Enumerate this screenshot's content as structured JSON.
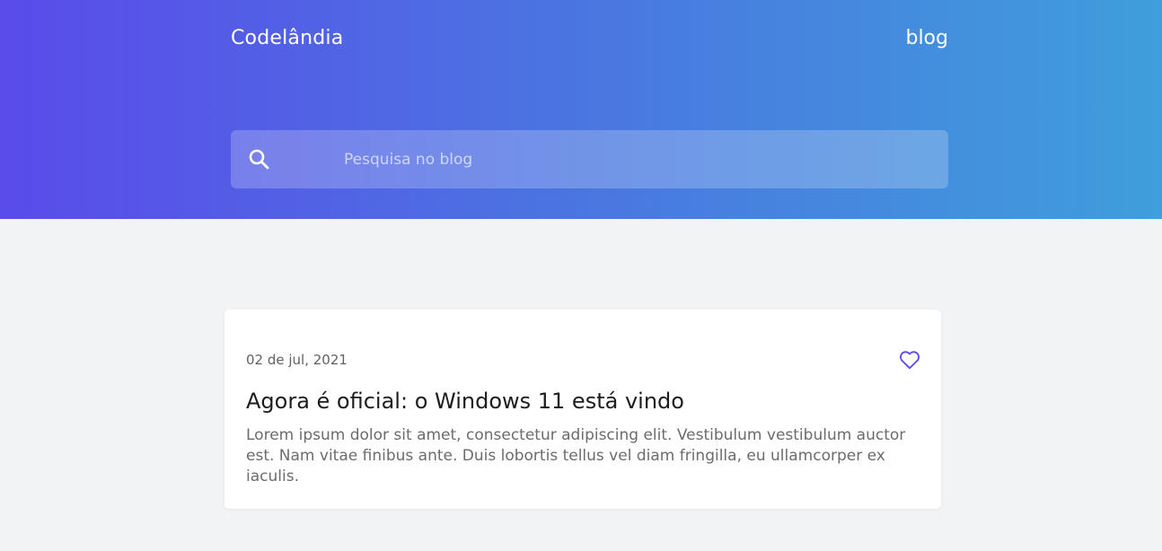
{
  "header": {
    "brand": "Codelândia",
    "nav_blog": "blog",
    "gradient": [
      "#5a4bea",
      "#4a76e1",
      "#3f9edb"
    ]
  },
  "search": {
    "placeholder": "Pesquisa no blog",
    "value": "",
    "icon": "search-icon"
  },
  "post": {
    "date": "02 de jul, 2021",
    "title": "Agora é oficial: o Windows 11 está vindo",
    "excerpt": "Lorem ipsum dolor sit amet, consectetur adipiscing elit. Vestibulum vestibulum auctor est. Nam vitae finibus ante. Duis lobortis tellus vel diam fringilla, eu ullamcorper ex iaculis.",
    "like_icon": "heart-icon",
    "accent": "#5a4bea"
  }
}
